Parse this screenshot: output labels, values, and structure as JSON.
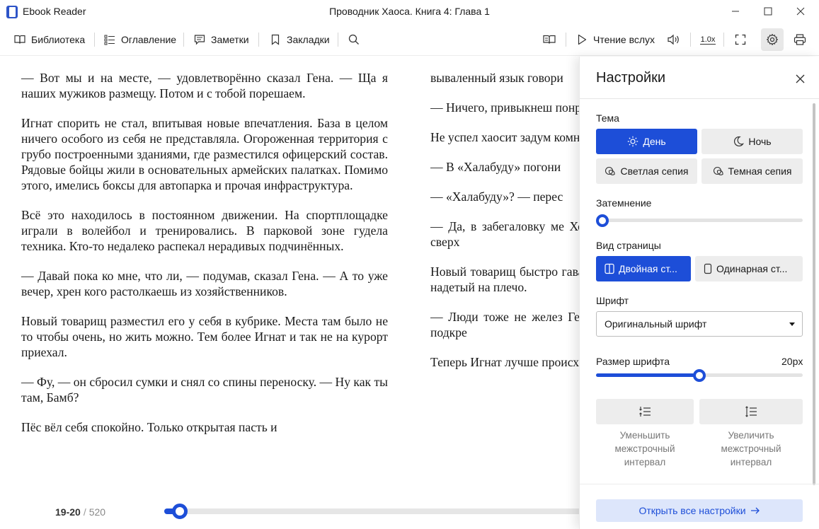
{
  "window": {
    "app_title": "Ebook Reader",
    "document_title": "Проводник Хаоса. Книга 4: Глава 1"
  },
  "toolbar": {
    "library": "Библиотека",
    "contents": "Оглавление",
    "notes": "Заметки",
    "bookmarks": "Закладки",
    "read_aloud": "Чтение вслух",
    "speed": "1.0x"
  },
  "book": {
    "left_paragraphs": [
      "— Вот мы и на месте, — удовлетворённо сказал Гена. — Ща я наших мужиков размещу. Потом и с тобой порешаем.",
      "Игнат спорить не стал, впитывая новые впечатления. База в целом ничего особого из себя не представляла. Огороженная территория с грубо построенными зданиями, где разместился офицерский состав. Рядовые бойцы жили в основательных армейских палатках. Помимо этого, имелись боксы для автопарка и прочая инфраструктура.",
      "Всё это находилось в постоянном движении. На спортплощадке играли в волейбол и тренировались. В парковой зоне гудела техника. Кто-то недалеко распекал нерадивых подчинённых.",
      "— Давай пока ко мне, что ли, — подумав, сказал Гена. — А то уже вечер, хрен кого растолкаешь из хозяйственников.",
      "Новый товарищ разместил его у себя в кубрике. Места там было не то чтобы очень, но жить можно. Тем более Игнат и так не на курорт приехал.",
      "— Фу, — он сбросил сумки и снял со спины переноску. — Ну как ты там, Бамб?",
      "Пёс вёл себя спокойно. Только открытая пасть и"
    ],
    "right_paragraphs": [
      "вываленный язык говори",
      "— Ничего, привыкнеш понравится.",
      "Не успел хаосит задум комнату вновь ворвался",
      "— В «Халабуду» погони",
      "— «Халабуду»? — перес",
      "— Да, в забегаловку ме Хоть немного посидет увидишь, может и сверх",
      "Новый товарищ быстро гавайку и шорты. Об отдыхающего. Портил надетый на плечо.",
      "— Люди тоже не желез Гена. — Про ротацию л приехало первое подкре",
      "Теперь Игнат лучше происходящее в мире, н"
    ]
  },
  "progress": {
    "current": "19-20",
    "separator": "/",
    "total": "520",
    "fraction": 0.036
  },
  "settings": {
    "title": "Настройки",
    "theme_label": "Тема",
    "themes": [
      {
        "label": "День",
        "icon": "sun-icon",
        "selected": true
      },
      {
        "label": "Ночь",
        "icon": "moon-icon",
        "selected": false
      },
      {
        "label": "Светлая сепия",
        "icon": "sepia-icon",
        "selected": false
      },
      {
        "label": "Темная сепия",
        "icon": "sepia-icon",
        "selected": false
      }
    ],
    "dimming_label": "Затемнение",
    "dimming_value": 0.0,
    "page_view_label": "Вид страницы",
    "page_views": [
      {
        "label": "Двойная ст...",
        "selected": true
      },
      {
        "label": "Одинарная ст...",
        "selected": false
      }
    ],
    "font_label": "Шрифт",
    "font_value": "Оригинальный шрифт",
    "font_size_label": "Размер шрифта",
    "font_size_value": "20px",
    "font_size_fraction": 0.5,
    "decrease_spacing": "Уменьшить межстрочный интервал",
    "increase_spacing": "Увеличить межстрочный интервал",
    "open_all": "Открыть все настройки"
  },
  "colors": {
    "accent": "#1d4ed8",
    "button_bg": "#ededed",
    "link_bg": "#dde6fb"
  }
}
